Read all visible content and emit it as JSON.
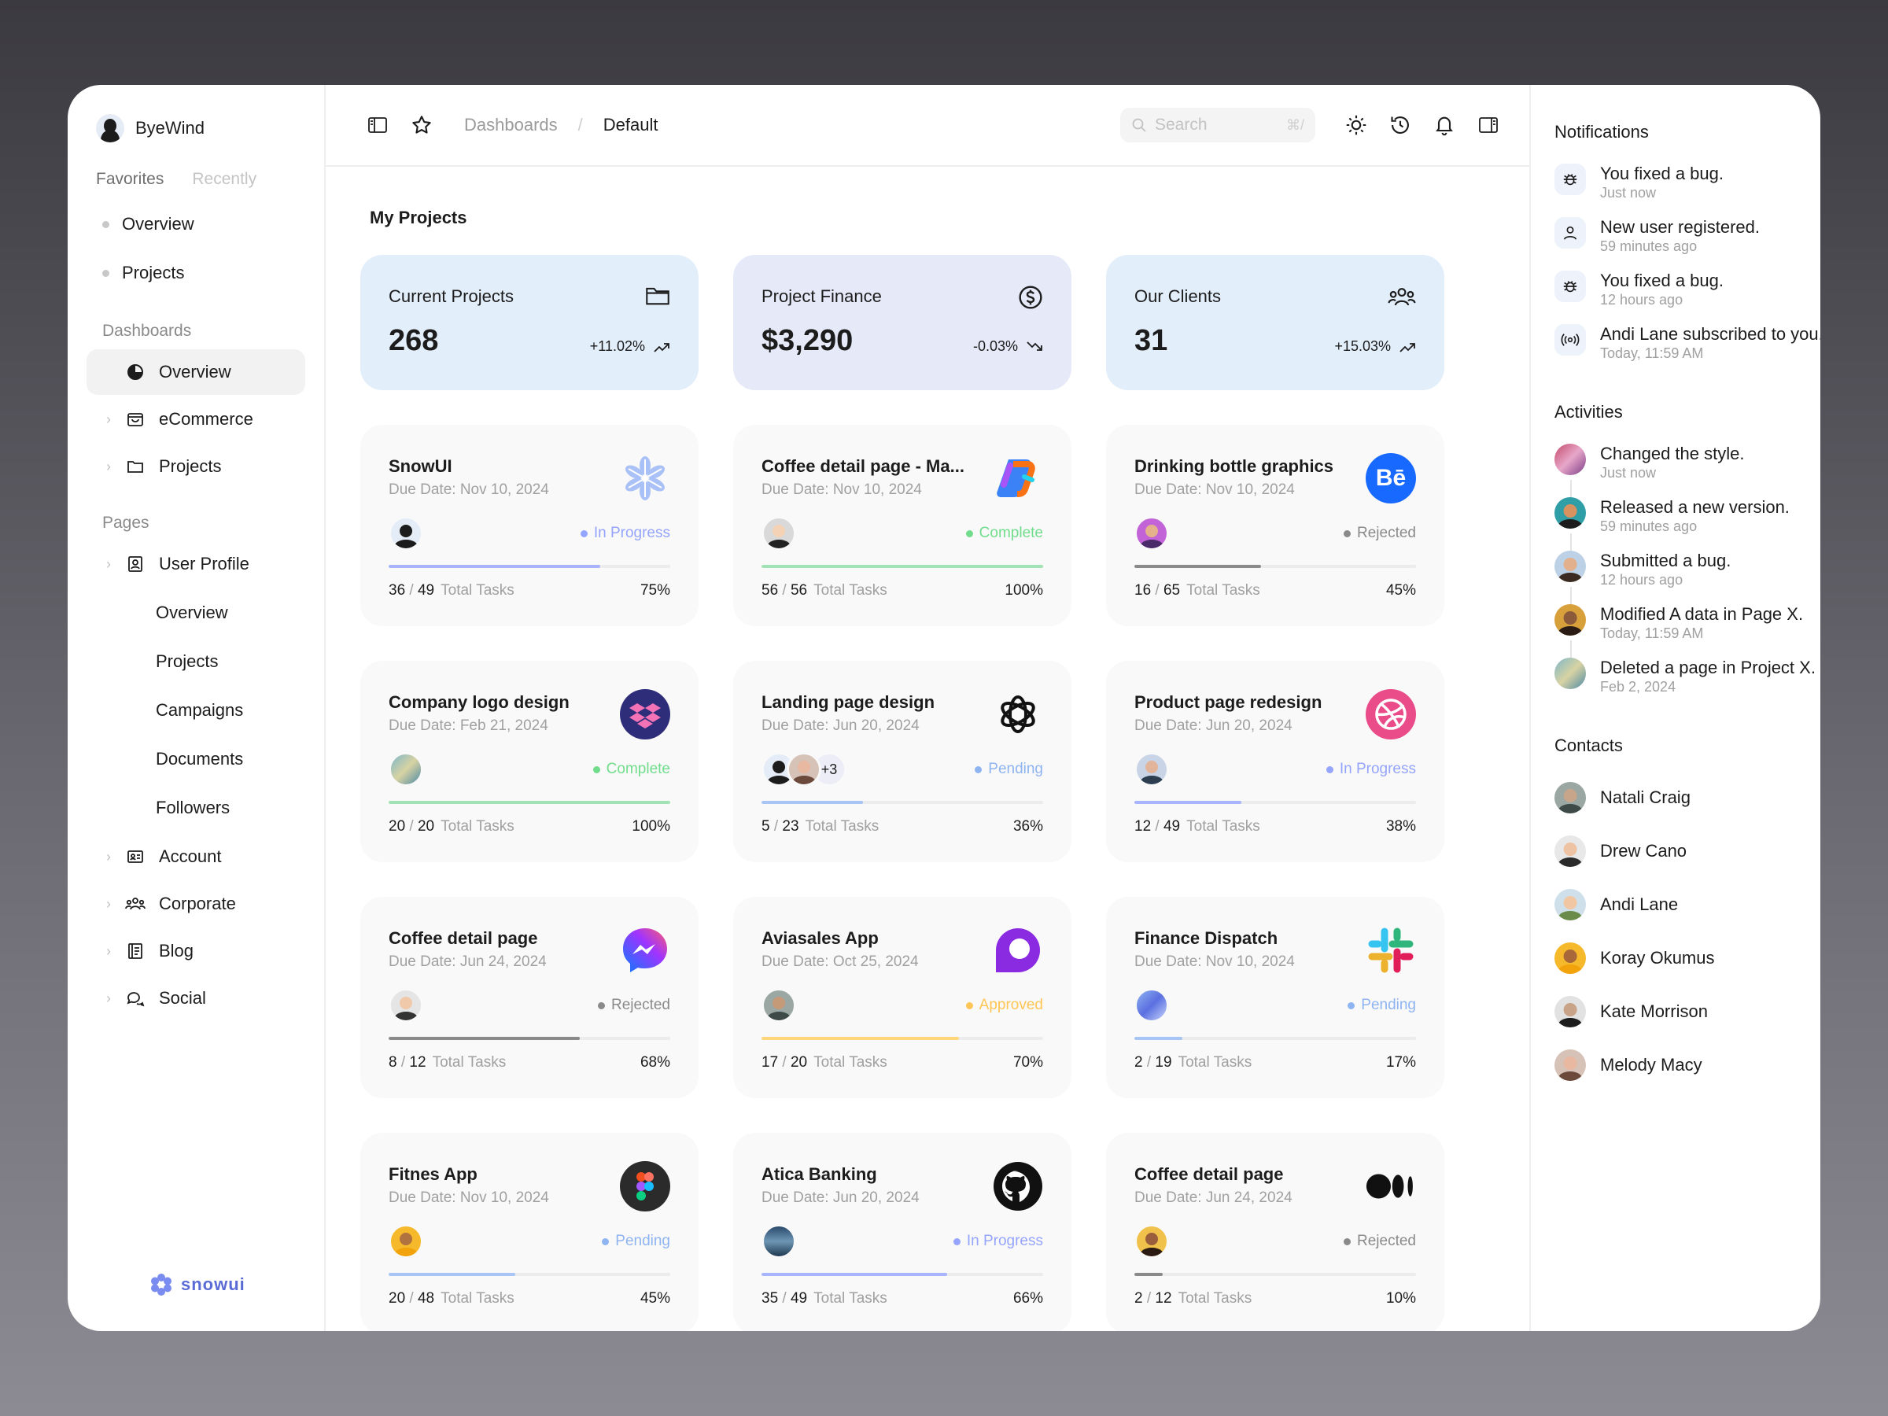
{
  "brand": {
    "name": "ByeWind"
  },
  "sidebar": {
    "tabs": [
      "Favorites",
      "Recently"
    ],
    "favorites": [
      "Overview",
      "Projects"
    ],
    "dashboards_label": "Dashboards",
    "dashboards": [
      {
        "label": "Overview",
        "icon": "pie-chart-icon",
        "active": true
      },
      {
        "label": "eCommerce",
        "icon": "shopping-bag-icon"
      },
      {
        "label": "Projects",
        "icon": "folder-icon"
      }
    ],
    "pages_label": "Pages",
    "user_profile": {
      "label": "User Profile",
      "icon": "id-badge-icon"
    },
    "user_profile_sub": [
      "Overview",
      "Projects",
      "Campaigns",
      "Documents",
      "Followers"
    ],
    "pages": [
      {
        "label": "Account",
        "icon": "id-card-icon"
      },
      {
        "label": "Corporate",
        "icon": "users-icon"
      },
      {
        "label": "Blog",
        "icon": "notebook-icon"
      },
      {
        "label": "Social",
        "icon": "chat-bubbles-icon"
      }
    ],
    "footer_logo": "snowui"
  },
  "topbar": {
    "breadcrumb": [
      "Dashboards",
      "Default"
    ],
    "search_placeholder": "Search",
    "search_shortcut": "⌘/"
  },
  "main": {
    "title": "My Projects",
    "stats": [
      {
        "label": "Current Projects",
        "value": "268",
        "delta": "+11.02%",
        "trend": "up",
        "icon": "folder-icon",
        "bg": "blue"
      },
      {
        "label": "Project Finance",
        "value": "$3,290",
        "delta": "-0.03%",
        "trend": "down",
        "icon": "dollar-circle-icon",
        "bg": "lav"
      },
      {
        "label": "Our Clients",
        "value": "31",
        "delta": "+15.03%",
        "trend": "up",
        "icon": "users-icon",
        "bg": "blue"
      }
    ],
    "projects": [
      {
        "title": "SnowUI",
        "due": "Due Date: Nov 10, 2024",
        "logo": "snowflake-logo-icon",
        "status": "In Progress",
        "status_color": "#95a4fc",
        "done": "36",
        "total": "49",
        "tasks_label": "Total Tasks",
        "pct": "75%",
        "progress": 0.75,
        "bar_color": "#a8b4fc",
        "avatars": [
          "a1"
        ],
        "more": ""
      },
      {
        "title": "Coffee detail page - Ma...",
        "due": "Due Date: Nov 10, 2024",
        "logo": "copilot-logo-icon",
        "status": "Complete",
        "status_color": "#71dd8c",
        "done": "56",
        "total": "56",
        "tasks_label": "Total Tasks",
        "pct": "100%",
        "progress": 1.0,
        "bar_color": "#a1e3b5",
        "avatars": [
          "a2"
        ],
        "more": ""
      },
      {
        "title": "Drinking bottle graphics",
        "due": "Due Date: Nov 10, 2024",
        "logo": "behance-logo-icon",
        "status": "Rejected",
        "status_color": "#8a8a8a",
        "done": "16",
        "total": "65",
        "tasks_label": "Total Tasks",
        "pct": "45%",
        "progress": 0.45,
        "bar_color": "#8a8a8a",
        "avatars": [
          "a3"
        ],
        "more": ""
      },
      {
        "title": "Company logo design",
        "due": "Due Date: Feb 21, 2024",
        "logo": "dropbox-logo-icon",
        "status": "Complete",
        "status_color": "#71dd8c",
        "done": "20",
        "total": "20",
        "tasks_label": "Total Tasks",
        "pct": "100%",
        "progress": 1.0,
        "bar_color": "#a1e3b5",
        "avatars": [
          "a4"
        ],
        "more": ""
      },
      {
        "title": "Landing page design",
        "due": "Due Date: Jun 20, 2024",
        "logo": "openai-logo-icon",
        "status": "Pending",
        "status_color": "#8fb4f2",
        "done": "5",
        "total": "23",
        "tasks_label": "Total Tasks",
        "pct": "36%",
        "progress": 0.36,
        "bar_color": "#a8c5f5",
        "avatars": [
          "a1",
          "a5"
        ],
        "more": "+3"
      },
      {
        "title": "Product page redesign",
        "due": "Due Date: Jun 20, 2024",
        "logo": "dribbble-logo-icon",
        "status": "In Progress",
        "status_color": "#95a4fc",
        "done": "12",
        "total": "49",
        "tasks_label": "Total Tasks",
        "pct": "38%",
        "progress": 0.38,
        "bar_color": "#a8b4fc",
        "avatars": [
          "a6"
        ],
        "more": ""
      },
      {
        "title": "Coffee detail page",
        "due": "Due Date: Jun 24, 2024",
        "logo": "messenger-logo-icon",
        "status": "Rejected",
        "status_color": "#8a8a8a",
        "done": "8",
        "total": "12",
        "tasks_label": "Total Tasks",
        "pct": "68%",
        "progress": 0.68,
        "bar_color": "#8a8a8a",
        "avatars": [
          "a7"
        ],
        "more": ""
      },
      {
        "title": "Aviasales App",
        "due": "Due Date: Oct 25, 2024",
        "logo": "aviasales-logo-icon",
        "status": "Approved",
        "status_color": "#ffc555",
        "done": "17",
        "total": "20",
        "tasks_label": "Total Tasks",
        "pct": "70%",
        "progress": 0.7,
        "bar_color": "#ffd77a",
        "avatars": [
          "a8"
        ],
        "more": ""
      },
      {
        "title": "Finance Dispatch",
        "due": "Due Date: Nov 10, 2024",
        "logo": "slack-logo-icon",
        "status": "Pending",
        "status_color": "#8fb4f2",
        "done": "2",
        "total": "19",
        "tasks_label": "Total Tasks",
        "pct": "17%",
        "progress": 0.17,
        "bar_color": "#a8c5f5",
        "avatars": [
          "a9"
        ],
        "more": ""
      },
      {
        "title": "Fitnes App",
        "due": "Due Date: Nov 10, 2024",
        "logo": "figma-logo-icon",
        "status": "Pending",
        "status_color": "#8fb4f2",
        "done": "20",
        "total": "48",
        "tasks_label": "Total Tasks",
        "pct": "45%",
        "progress": 0.45,
        "bar_color": "#a8c5f5",
        "avatars": [
          "a10"
        ],
        "more": ""
      },
      {
        "title": "Atica Banking",
        "due": "Due Date: Jun 20, 2024",
        "logo": "github-logo-icon",
        "status": "In Progress",
        "status_color": "#95a4fc",
        "done": "35",
        "total": "49",
        "tasks_label": "Total Tasks",
        "pct": "66%",
        "progress": 0.66,
        "bar_color": "#a8b4fc",
        "avatars": [
          "a11"
        ],
        "more": ""
      },
      {
        "title": "Coffee detail page",
        "due": "Due Date: Jun 24, 2024",
        "logo": "medium-logo-icon",
        "status": "Rejected",
        "status_color": "#8a8a8a",
        "done": "2",
        "total": "12",
        "tasks_label": "Total Tasks",
        "pct": "10%",
        "progress": 0.1,
        "bar_color": "#8a8a8a",
        "avatars": [
          "a12"
        ],
        "more": ""
      }
    ]
  },
  "right": {
    "notifications_title": "Notifications",
    "notifications": [
      {
        "text": "You fixed a bug.",
        "time": "Just now",
        "icon": "bug-icon"
      },
      {
        "text": "New user registered.",
        "time": "59 minutes ago",
        "icon": "user-icon"
      },
      {
        "text": "You fixed a bug.",
        "time": "12 hours ago",
        "icon": "bug-icon"
      },
      {
        "text": "Andi Lane subscribed to you.",
        "time": "Today, 11:59 AM",
        "icon": "broadcast-icon"
      }
    ],
    "activities_title": "Activities",
    "activities": [
      {
        "text": "Changed the style.",
        "time": "Just now",
        "avatar": "r1"
      },
      {
        "text": "Released a new version.",
        "time": "59 minutes ago",
        "avatar": "r2"
      },
      {
        "text": "Submitted a bug.",
        "time": "12 hours ago",
        "avatar": "r3"
      },
      {
        "text": "Modified A data in Page X.",
        "time": "Today, 11:59 AM",
        "avatar": "r4"
      },
      {
        "text": "Deleted a page in Project X.",
        "time": "Feb 2, 2024",
        "avatar": "r5"
      }
    ],
    "contacts_title": "Contacts",
    "contacts": [
      "Natali Craig",
      "Drew Cano",
      "Andi Lane",
      "Koray Okumus",
      "Kate Morrison",
      "Melody Macy"
    ]
  }
}
